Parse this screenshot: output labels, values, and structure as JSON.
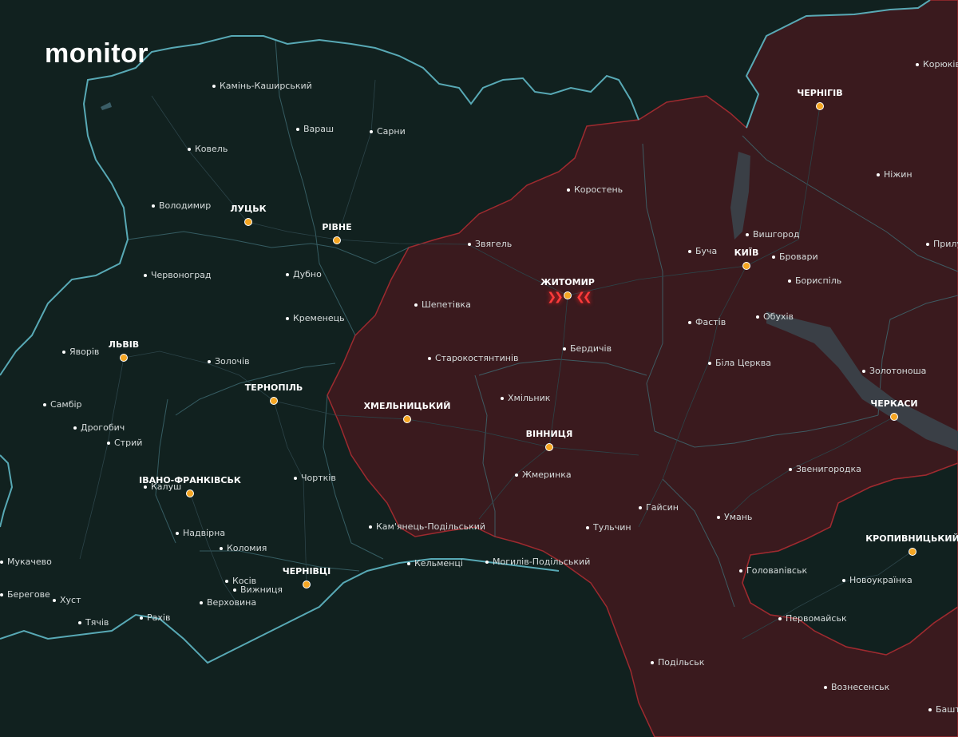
{
  "brand": "monitor",
  "colors": {
    "background": "#11211f",
    "alert_fill": "#3a1a1e",
    "alert_border": "#9e2a2f",
    "border": "#58a9b5",
    "capital_dot": "#f5a623",
    "strike": "#ff3b3b"
  },
  "capitals": [
    {
      "id": "lutsk",
      "label": "ЛУЦЬК"
    },
    {
      "id": "rivne",
      "label": "РІВНЕ"
    },
    {
      "id": "lviv",
      "label": "ЛЬВІВ"
    },
    {
      "id": "ternopil",
      "label": "ТЕРНОПІЛЬ"
    },
    {
      "id": "khmelnytskyi",
      "label": "ХМЕЛЬНИЦЬКИЙ"
    },
    {
      "id": "ivano",
      "label": "ІВАНО-ФРАНКІВСЬК"
    },
    {
      "id": "chernivtsi",
      "label": "ЧЕРНІВЦІ"
    },
    {
      "id": "zhytomyr",
      "label": "ЖИТОМИР"
    },
    {
      "id": "vinnytsia",
      "label": "ВІННИЦЯ"
    },
    {
      "id": "kyiv",
      "label": "КИЇВ"
    },
    {
      "id": "chernihiv",
      "label": "ЧЕРНІГІВ"
    },
    {
      "id": "cherkasy",
      "label": "ЧЕРКАСИ"
    },
    {
      "id": "kropyvnytskyi",
      "label": "КРОПИВНИЦЬКИЙ"
    }
  ],
  "cities": [
    "Камінь-Каширський",
    "Вараш",
    "Сарни",
    "Ковель",
    "Володимир",
    "Червоноград",
    "Дубно",
    "Кременець",
    "Яворів",
    "Золочів",
    "Самбір",
    "Дрогобич",
    "Стрий",
    "Калуш",
    "Чортків",
    "Надвірна",
    "Коломия",
    "Кам'янець-Подільський",
    "Мукачево",
    "Хуст",
    "Берегове",
    "Тячів",
    "Рахів",
    "Косів",
    "Вижниця",
    "Верховина",
    "Кельменці",
    "Могилів-Подільський",
    "Звягель",
    "Коростень",
    "Шепетівка",
    "Старокостянтинів",
    "Хмільник",
    "Бердичів",
    "Жмеринка",
    "Гайсин",
    "Тульчин",
    "Вишгород",
    "Буча",
    "Бровари",
    "Бориспіль",
    "Фастів",
    "Обухів",
    "Біла Церква",
    "Ніжин",
    "Корюківка",
    "Прилуки",
    "Золотоноша",
    "Звенигородка",
    "Умань",
    "Головanівськ",
    "Новоукраїнка",
    "Первомайськ",
    "Подільськ",
    "Вознесенськ",
    "Бaшт"
  ]
}
